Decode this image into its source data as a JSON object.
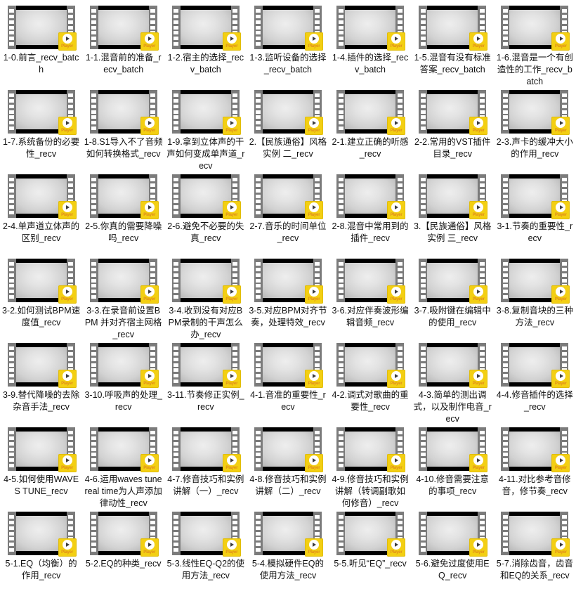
{
  "window": {
    "view_mode": "medium-icons-grid",
    "columns": 7,
    "rows": 7,
    "background_color": "#ffffff"
  },
  "icon": {
    "type": "video-file-thumbnail",
    "badge_label": "Player",
    "badge_color": "#f3cf13",
    "badge_text_color": "#e08c1a",
    "strip_color": "#000000",
    "rail_color": "#7b7b7b",
    "frame_color": "#d8d8d8"
  },
  "files": [
    {
      "name": "1-0.前言_recv_batch"
    },
    {
      "name": "1-1.混音前的准备_recv_batch"
    },
    {
      "name": "1-2.宿主的选择_recv_batch"
    },
    {
      "name": "1-3.监听设备的选择_recv_batch"
    },
    {
      "name": "1-4.插件的选择_recv_batch"
    },
    {
      "name": "1-5.混音有没有标准答案_recv_batch"
    },
    {
      "name": "1-6.混音是一个有创造性的工作_recv_batch"
    },
    {
      "name": "1-7.系统备份的必要性_recv"
    },
    {
      "name": "1-8.S1导入不了音频如何转换格式_recv"
    },
    {
      "name": "1-9.拿到立体声的干声如何变成单声道_recv"
    },
    {
      "name": "2.【民族通俗】风格实例 二_recv"
    },
    {
      "name": "2-1.建立正确的听感_recv"
    },
    {
      "name": "2-2.常用的VST插件目录_recv"
    },
    {
      "name": "2-3.声卡的缓冲大小的作用_recv"
    },
    {
      "name": "2-4.单声道立体声的区别_recv"
    },
    {
      "name": "2-5.你真的需要降噪吗_recv"
    },
    {
      "name": "2-6.避免不必要的失真_recv"
    },
    {
      "name": "2-7.音乐的时间单位_recv"
    },
    {
      "name": "2-8.混音中常用到的插件_recv"
    },
    {
      "name": "3.【民族通俗】风格实例 三_recv"
    },
    {
      "name": "3-1.节奏的重要性_recv"
    },
    {
      "name": "3-2.如何测试BPM速度值_recv"
    },
    {
      "name": "3-3.在录音前设置BPM 并对齐宿主网格_recv"
    },
    {
      "name": "3-4.收到没有对应BPM录制的干声怎么办_recv"
    },
    {
      "name": "3-5.对应BPM对齐节奏，处理特效_recv"
    },
    {
      "name": "3-6.对应伴奏波形编辑音频_recv"
    },
    {
      "name": "3-7.吸附键在编辑中的使用_recv"
    },
    {
      "name": "3-8.复制音块的三种方法_recv"
    },
    {
      "name": "3-9.替代降噪的去除杂音手法_recv"
    },
    {
      "name": "3-10.呼吸声的处理_recv"
    },
    {
      "name": "3-11.节奏修正实例_recv"
    },
    {
      "name": "4-1.音准的重要性_recv"
    },
    {
      "name": "4-2.调式对歌曲的重要性_recv"
    },
    {
      "name": "4-3.简单的测出调式，以及制作电音_recv"
    },
    {
      "name": "4-4.修音插件的选择_recv"
    },
    {
      "name": "4-5.如何使用WAVES TUNE_recv"
    },
    {
      "name": "4-6.运用waves tune real time为人声添加律动性_recv"
    },
    {
      "name": "4-7.修音技巧和实例讲解（一）_recv"
    },
    {
      "name": "4-8.修音技巧和实例讲解（二）_recv"
    },
    {
      "name": "4-9.修音技巧和实例讲解（转调副歌如何修音）_recv"
    },
    {
      "name": "4-10.修音需要注意的事项_recv"
    },
    {
      "name": "4-11.对比参考音修音，修节奏_recv"
    },
    {
      "name": "5-1.EQ（均衡）的作用_recv"
    },
    {
      "name": "5-2.EQ的种类_recv"
    },
    {
      "name": "5-3.线性EQ-Q2的使用方法_recv"
    },
    {
      "name": "5-4.模拟硬件EQ的使用方法_recv"
    },
    {
      "name": "5-5.听见“EQ”_recv"
    },
    {
      "name": "5-6.避免过度使用EQ_recv"
    },
    {
      "name": "5-7.消除齿音，齿音和EQ的关系_recv"
    }
  ]
}
